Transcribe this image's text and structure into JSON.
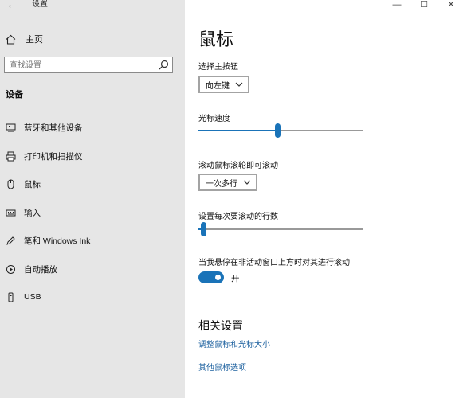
{
  "window": {
    "title": "设置",
    "back_glyph": "←",
    "controls": {
      "minimize": "—",
      "maximize": "☐",
      "close": "✕"
    }
  },
  "sidebar": {
    "home_label": "主页",
    "search_placeholder": "查找设置",
    "section_title": "设备",
    "items": [
      {
        "label": "蓝牙和其他设备",
        "icon": "bluetooth-devices-icon"
      },
      {
        "label": "打印机和扫描仪",
        "icon": "printer-icon"
      },
      {
        "label": "鼠标",
        "icon": "mouse-icon"
      },
      {
        "label": "输入",
        "icon": "keyboard-icon"
      },
      {
        "label": "笔和 Windows Ink",
        "icon": "pen-icon"
      },
      {
        "label": "自动播放",
        "icon": "autoplay-icon"
      },
      {
        "label": "USB",
        "icon": "usb-icon"
      }
    ]
  },
  "main": {
    "title": "鼠标",
    "primary_button": {
      "label": "选择主按钮",
      "value": "向左键"
    },
    "cursor_speed": {
      "label": "光标速度",
      "level": 0.48
    },
    "scroll_mode": {
      "label": "滚动鼠标滚轮即可滚动",
      "value": "一次多行"
    },
    "scroll_lines": {
      "label": "设置每次要滚动的行数",
      "level": 0.03
    },
    "inactive_scroll": {
      "label": "当我悬停在非活动窗口上方时对其进行滚动",
      "state": "开",
      "on": true
    },
    "related": {
      "title": "相关设置",
      "links": [
        "调整鼠标和光标大小",
        "其他鼠标选项"
      ]
    }
  },
  "colors": {
    "accent": "#1a73b8",
    "sidebar_bg": "#e6e6e6",
    "link": "#1a5f9e"
  }
}
